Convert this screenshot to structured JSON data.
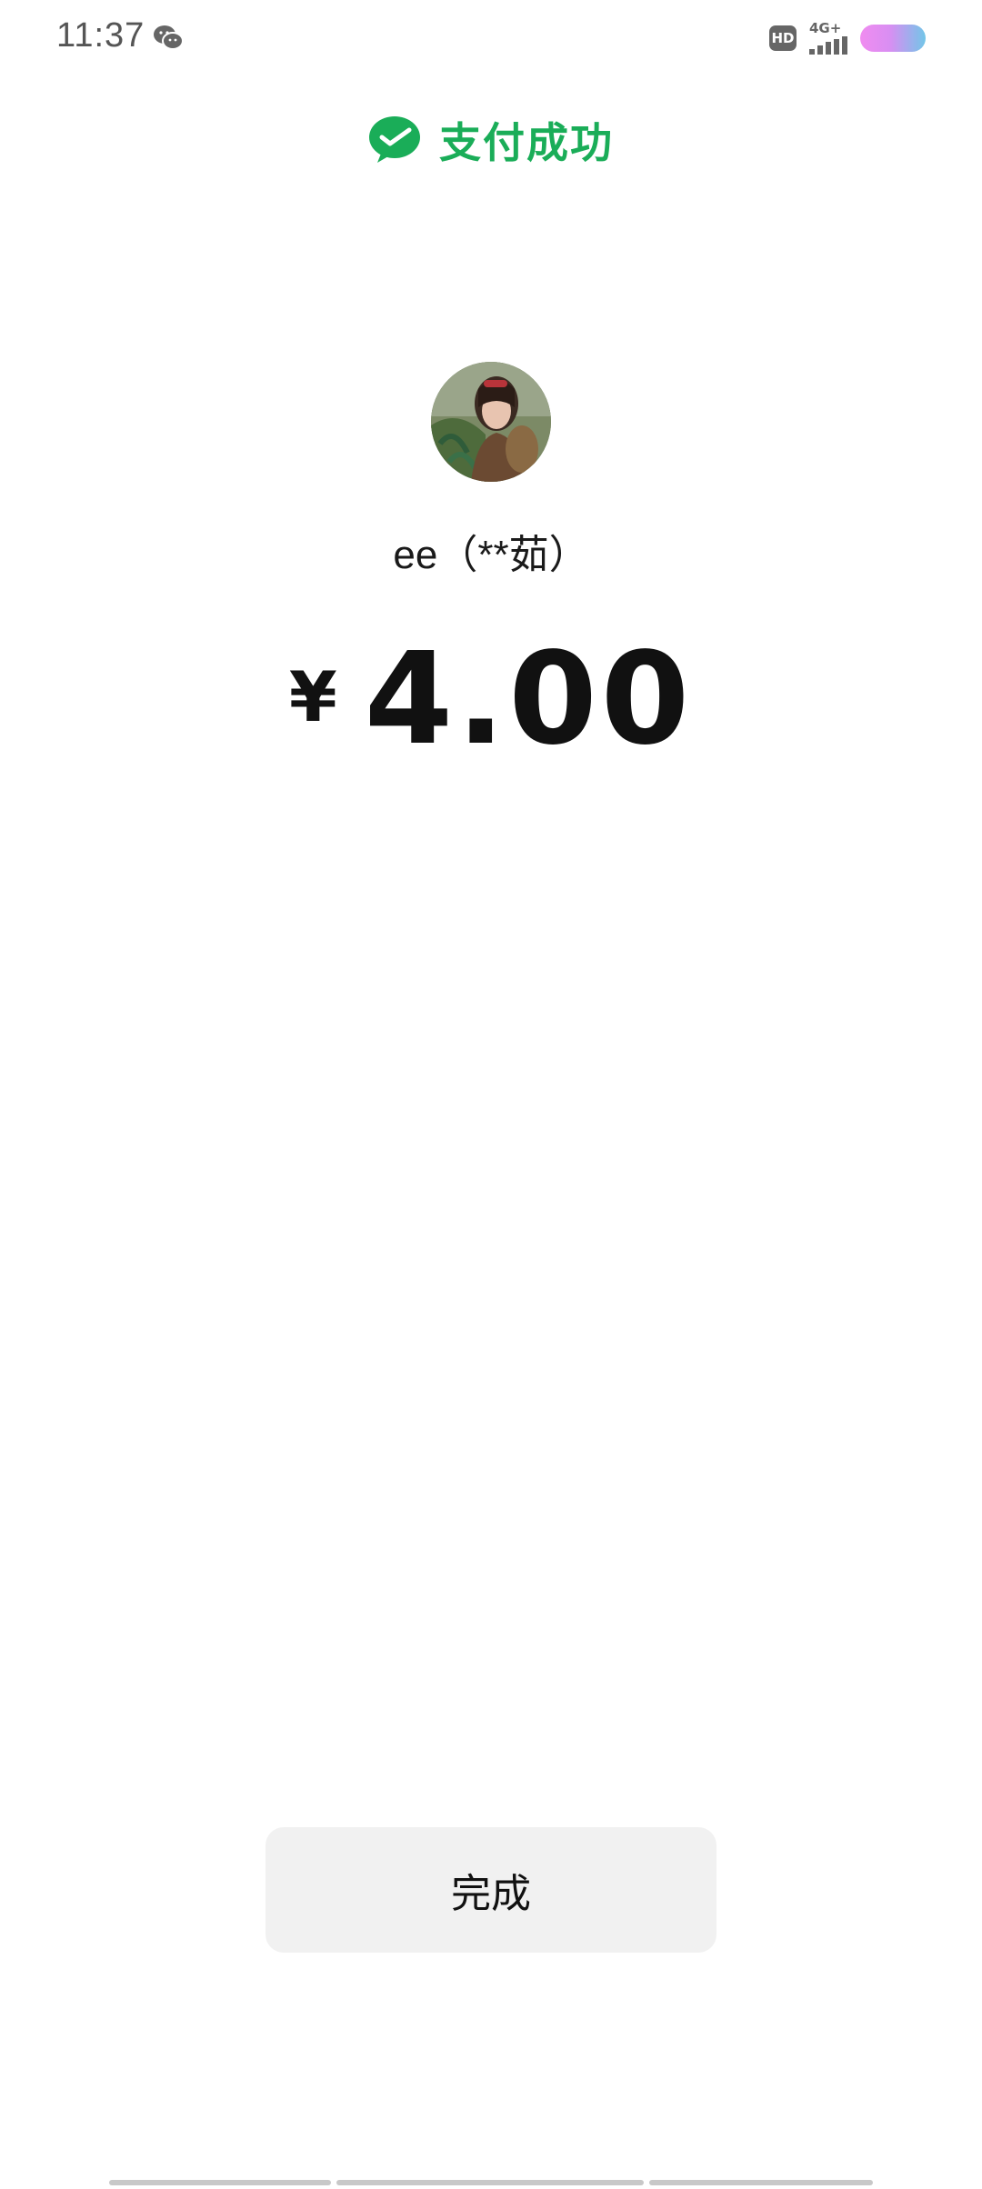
{
  "status_bar": {
    "time": "11:37",
    "notification_icon": "wechat-icon",
    "hd_label": "HD",
    "network_label": "4G+",
    "battery_colors": [
      "#f08cf0",
      "#72c6e8"
    ]
  },
  "header": {
    "icon": "wechat-pay-check-icon",
    "title": "支付成功",
    "color": "#1aad58"
  },
  "payee": {
    "avatar": "avatar",
    "name": "ee（**茹）"
  },
  "amount": {
    "currency_symbol": "¥",
    "value": "4.00"
  },
  "actions": {
    "done_label": "完成"
  }
}
